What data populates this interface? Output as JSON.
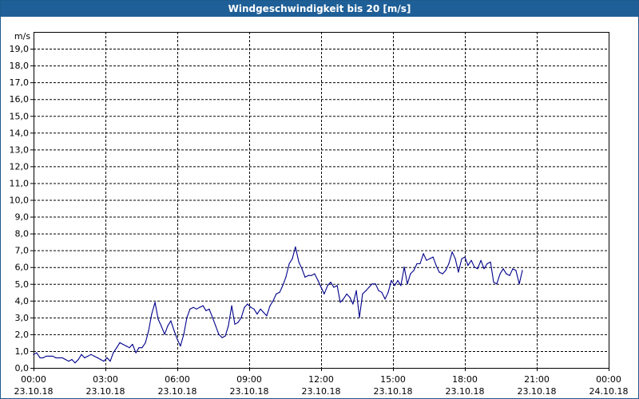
{
  "window": {
    "title": "Windgeschwindigkeit bis 20 [m/s]"
  },
  "chart_data": {
    "type": "line",
    "title": "Windgeschwindigkeit bis 20 [m/s]",
    "ylabel": "m/s",
    "xlabel": "",
    "ylim": [
      0,
      20
    ],
    "xlim_hours": [
      0,
      24
    ],
    "grid": true,
    "grid_style": "dashed",
    "yticks": [
      "0,0",
      "1,0",
      "2,0",
      "3,0",
      "4,0",
      "5,0",
      "6,0",
      "7,0",
      "8,0",
      "9,0",
      "10,0",
      "11,0",
      "12,0",
      "13,0",
      "14,0",
      "15,0",
      "16,0",
      "17,0",
      "18,0",
      "19,0"
    ],
    "xticks": [
      {
        "time": "00:00",
        "date": "23.10.18"
      },
      {
        "time": "03:00",
        "date": "23.10.18"
      },
      {
        "time": "06:00",
        "date": "23.10.18"
      },
      {
        "time": "09:00",
        "date": "23.10.18"
      },
      {
        "time": "12:00",
        "date": "23.10.18"
      },
      {
        "time": "15:00",
        "date": "23.10.18"
      },
      {
        "time": "18:00",
        "date": "23.10.18"
      },
      {
        "time": "21:00",
        "date": "23.10.18"
      },
      {
        "time": "00:00",
        "date": "24.10.18"
      }
    ],
    "series": [
      {
        "color": "#00008b",
        "points": [
          [
            0.0,
            0.8
          ],
          [
            0.13,
            0.9
          ],
          [
            0.27,
            0.6
          ],
          [
            0.4,
            0.6
          ],
          [
            0.53,
            0.7
          ],
          [
            0.67,
            0.7
          ],
          [
            0.8,
            0.7
          ],
          [
            0.93,
            0.6
          ],
          [
            1.07,
            0.6
          ],
          [
            1.2,
            0.6
          ],
          [
            1.33,
            0.5
          ],
          [
            1.47,
            0.4
          ],
          [
            1.6,
            0.5
          ],
          [
            1.73,
            0.3
          ],
          [
            1.87,
            0.5
          ],
          [
            2.0,
            0.8
          ],
          [
            2.13,
            0.6
          ],
          [
            2.27,
            0.7
          ],
          [
            2.4,
            0.8
          ],
          [
            2.53,
            0.7
          ],
          [
            2.67,
            0.6
          ],
          [
            2.8,
            0.5
          ],
          [
            2.93,
            0.4
          ],
          [
            3.07,
            0.6
          ],
          [
            3.2,
            0.4
          ],
          [
            3.33,
            0.9
          ],
          [
            3.47,
            1.2
          ],
          [
            3.6,
            1.5
          ],
          [
            3.73,
            1.4
          ],
          [
            3.87,
            1.3
          ],
          [
            4.0,
            1.2
          ],
          [
            4.13,
            1.4
          ],
          [
            4.27,
            0.9
          ],
          [
            4.4,
            1.2
          ],
          [
            4.53,
            1.2
          ],
          [
            4.67,
            1.5
          ],
          [
            4.8,
            2.2
          ],
          [
            4.93,
            3.2
          ],
          [
            5.07,
            3.9
          ],
          [
            5.2,
            2.9
          ],
          [
            5.33,
            2.5
          ],
          [
            5.47,
            2.0
          ],
          [
            5.6,
            2.5
          ],
          [
            5.73,
            2.8
          ],
          [
            5.87,
            2.2
          ],
          [
            6.0,
            1.7
          ],
          [
            6.13,
            1.3
          ],
          [
            6.27,
            2.0
          ],
          [
            6.4,
            3.0
          ],
          [
            6.53,
            3.5
          ],
          [
            6.67,
            3.6
          ],
          [
            6.8,
            3.5
          ],
          [
            6.93,
            3.6
          ],
          [
            7.07,
            3.7
          ],
          [
            7.2,
            3.4
          ],
          [
            7.33,
            3.5
          ],
          [
            7.47,
            3.0
          ],
          [
            7.6,
            2.5
          ],
          [
            7.73,
            2.0
          ],
          [
            7.87,
            1.8
          ],
          [
            8.0,
            1.9
          ],
          [
            8.13,
            2.5
          ],
          [
            8.27,
            3.7
          ],
          [
            8.4,
            2.6
          ],
          [
            8.53,
            2.7
          ],
          [
            8.67,
            3.0
          ],
          [
            8.8,
            3.6
          ],
          [
            8.93,
            3.8
          ],
          [
            9.07,
            3.6
          ],
          [
            9.2,
            3.5
          ],
          [
            9.33,
            3.2
          ],
          [
            9.47,
            3.5
          ],
          [
            9.6,
            3.3
          ],
          [
            9.73,
            3.1
          ],
          [
            9.87,
            3.7
          ],
          [
            10.0,
            4.0
          ],
          [
            10.13,
            4.4
          ],
          [
            10.27,
            4.5
          ],
          [
            10.4,
            4.9
          ],
          [
            10.53,
            5.4
          ],
          [
            10.67,
            6.2
          ],
          [
            10.8,
            6.5
          ],
          [
            10.93,
            7.2
          ],
          [
            11.07,
            6.3
          ],
          [
            11.2,
            5.9
          ],
          [
            11.33,
            5.4
          ],
          [
            11.47,
            5.5
          ],
          [
            11.6,
            5.5
          ],
          [
            11.73,
            5.6
          ],
          [
            11.87,
            5.2
          ],
          [
            12.0,
            4.8
          ],
          [
            12.13,
            4.4
          ],
          [
            12.27,
            4.9
          ],
          [
            12.4,
            5.1
          ],
          [
            12.53,
            4.8
          ],
          [
            12.67,
            4.9
          ],
          [
            12.8,
            3.9
          ],
          [
            12.93,
            4.1
          ],
          [
            13.07,
            4.4
          ],
          [
            13.2,
            4.2
          ],
          [
            13.33,
            3.8
          ],
          [
            13.47,
            4.6
          ],
          [
            13.6,
            3.0
          ],
          [
            13.73,
            4.4
          ],
          [
            13.87,
            4.6
          ],
          [
            14.0,
            4.8
          ],
          [
            14.13,
            5.0
          ],
          [
            14.27,
            5.0
          ],
          [
            14.4,
            4.6
          ],
          [
            14.53,
            4.5
          ],
          [
            14.67,
            4.1
          ],
          [
            14.8,
            4.5
          ],
          [
            14.93,
            5.2
          ],
          [
            15.07,
            4.9
          ],
          [
            15.2,
            5.2
          ],
          [
            15.33,
            4.9
          ],
          [
            15.47,
            6.0
          ],
          [
            15.6,
            5.0
          ],
          [
            15.73,
            5.6
          ],
          [
            15.87,
            5.8
          ],
          [
            16.0,
            6.2
          ],
          [
            16.13,
            6.2
          ],
          [
            16.27,
            6.8
          ],
          [
            16.4,
            6.4
          ],
          [
            16.53,
            6.5
          ],
          [
            16.67,
            6.6
          ],
          [
            16.8,
            6.1
          ],
          [
            16.93,
            5.7
          ],
          [
            17.07,
            5.6
          ],
          [
            17.2,
            5.8
          ],
          [
            17.33,
            6.2
          ],
          [
            17.47,
            6.9
          ],
          [
            17.6,
            6.5
          ],
          [
            17.73,
            5.7
          ],
          [
            17.87,
            6.5
          ],
          [
            18.0,
            6.6
          ],
          [
            18.13,
            6.1
          ],
          [
            18.27,
            6.4
          ],
          [
            18.4,
            6.0
          ],
          [
            18.53,
            5.9
          ],
          [
            18.67,
            6.4
          ],
          [
            18.8,
            5.9
          ],
          [
            18.93,
            6.2
          ],
          [
            19.07,
            6.3
          ],
          [
            19.2,
            5.1
          ],
          [
            19.33,
            5.0
          ],
          [
            19.47,
            5.6
          ],
          [
            19.6,
            5.9
          ],
          [
            19.73,
            5.6
          ],
          [
            19.87,
            5.5
          ],
          [
            20.0,
            5.9
          ],
          [
            20.13,
            5.8
          ],
          [
            20.27,
            5.0
          ],
          [
            20.4,
            5.8
          ]
        ],
        "x_unit": "hours since 23.10.18 00:00",
        "note_scale": "full axis 00:00 23.10.18 to 00:00 24.10.18 spans 24 h"
      }
    ]
  }
}
